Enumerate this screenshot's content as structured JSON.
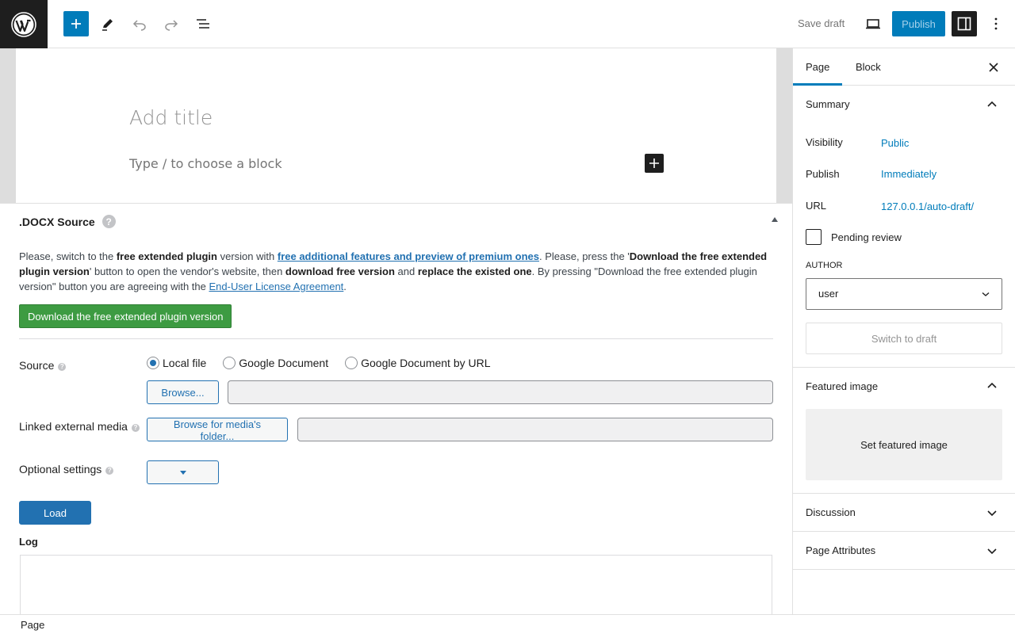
{
  "toolbar": {
    "save_draft": "Save draft",
    "publish": "Publish"
  },
  "editor": {
    "title_placeholder": "Add title",
    "block_placeholder": "Type / to choose a block"
  },
  "metabox": {
    "title": ".DOCX Source",
    "help": "?",
    "notice": {
      "t1": "Please, switch to the ",
      "b1": "free extended plugin",
      "t2": " version with ",
      "link1": "free additional features and preview of premium ones",
      "t3": ". Please, press the '",
      "b2": "Download the free extended plugin version",
      "t4": "' button to open the vendor's website, then ",
      "b3": "download free version",
      "t5": " and ",
      "b4": "replace the existed one",
      "t6": ". By pressing \"Download the free extended plugin version\" button you are agreeing with the ",
      "link2": "End-User License Agreement",
      "t7": "."
    },
    "download_button": "Download the free extended plugin version",
    "source_label": "Source",
    "source_options": [
      "Local file",
      "Google Document",
      "Google Document by URL"
    ],
    "browse_button": "Browse...",
    "linked_media_label": "Linked external media",
    "browse_media_button": "Browse for media's folder...",
    "optional_settings_label": "Optional settings",
    "load_button": "Load",
    "log_label": "Log"
  },
  "sidebar": {
    "tabs": [
      "Page",
      "Block"
    ],
    "summary": {
      "title": "Summary",
      "visibility_label": "Visibility",
      "visibility_value": "Public",
      "publish_label": "Publish",
      "publish_value": "Immediately",
      "url_label": "URL",
      "url_value": "127.0.0.1/auto-draft/",
      "pending_review": "Pending review",
      "author_label": "AUTHOR",
      "author_value": "user",
      "switch_to_draft": "Switch to draft"
    },
    "featured_image": {
      "title": "Featured image",
      "set_button": "Set featured image"
    },
    "discussion": "Discussion",
    "page_attributes": "Page Attributes"
  },
  "footer": {
    "breadcrumb": "Page"
  },
  "colors": {
    "accent": "#007cba",
    "wp_admin_blue": "#2271b1",
    "download_green": "#3d9b42"
  }
}
